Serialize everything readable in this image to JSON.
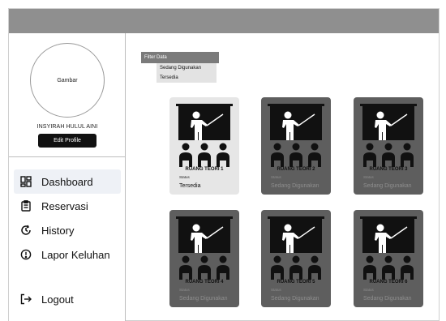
{
  "profile": {
    "avatar_text": "Gambar",
    "name": "INSYIRAH HULUL AINI",
    "edit_label": "Edit Profile"
  },
  "nav": {
    "dashboard": "Dashboard",
    "reservasi": "Reservasi",
    "history": "History",
    "lapor": "Lapor Keluhan",
    "logout": "Logout"
  },
  "filter": {
    "label": "Filter Data",
    "options": [
      "Sedang Digunakan",
      "Tersedia"
    ]
  },
  "rooms": [
    {
      "title": "RUANG TEORI 1",
      "status_label": "Status",
      "status": "Tersedia"
    },
    {
      "title": "RUANG TEORI 2",
      "status_label": "Status",
      "status": "Sedang Digunakan"
    },
    {
      "title": "RUANG TEORI 3",
      "status_label": "Status",
      "status": "Sedang Digunakan"
    },
    {
      "title": "RUANG TEORI 4",
      "status_label": "Status",
      "status": "Sedang Digunakan"
    },
    {
      "title": "RUANG TEORI 5",
      "status_label": "Status",
      "status": "Sedang Digunakan"
    },
    {
      "title": "RUANG TEORI 6",
      "status_label": "Status",
      "status": "Sedang Digunakan"
    }
  ],
  "colors": {
    "topbar": "#8f8f8f",
    "card_in_use": "#5e5e5e",
    "card_available": "#e6e6e6",
    "active_nav": "#eef1f6"
  },
  "icons": {
    "dashboard": "dashboard-grid-icon",
    "reservasi": "clipboard-list-icon",
    "history": "history-clock-icon",
    "lapor": "alert-circle-icon",
    "logout": "logout-arrow-icon",
    "room": "classroom-teacher-icon"
  }
}
